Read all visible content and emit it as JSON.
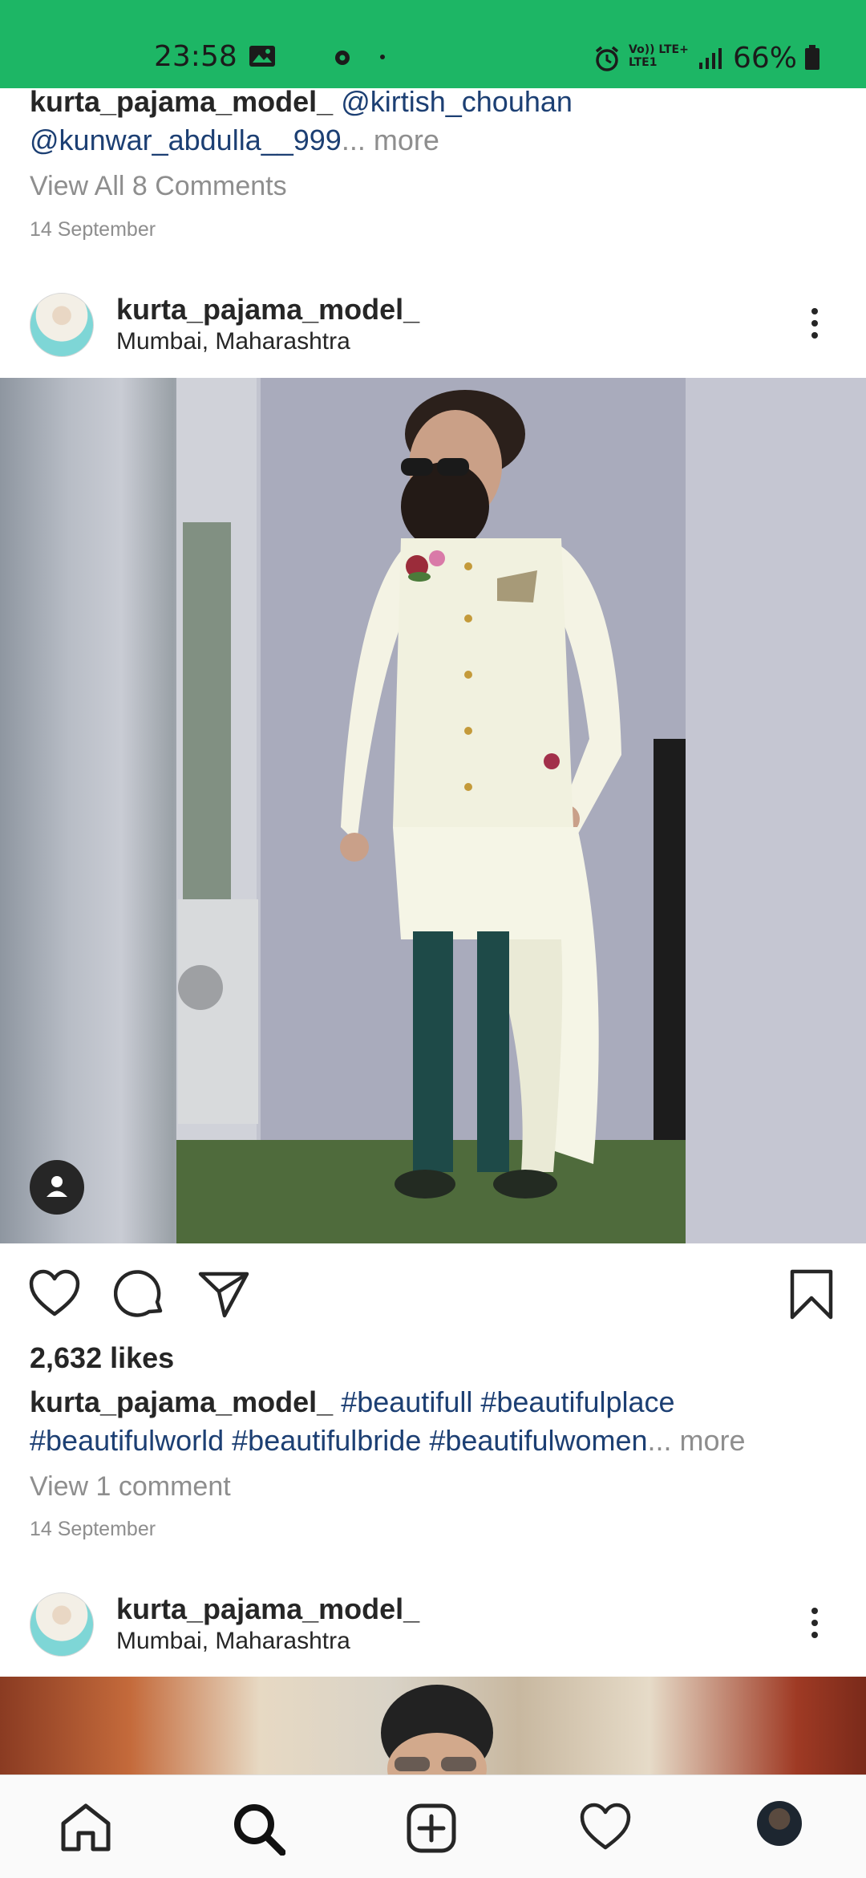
{
  "status_bar": {
    "time": "23:58",
    "network_top": "Vo)) LTE+",
    "network_bottom": "LTE1",
    "battery": "66%"
  },
  "prev_post": {
    "caption_user": "kurta_pajama_model_",
    "caption_line1_tag": "@kirtish_chouhan",
    "caption_line2_tag": "@kunwar_abdulla__999",
    "more": "... more",
    "view_comments": "View All 8 Comments",
    "date": "14 September"
  },
  "post": {
    "username": "kurta_pajama_model_",
    "location": "Mumbai, Maharashtra",
    "likes": "2,632 likes",
    "caption_user": "kurta_pajama_model_",
    "caption_line1_tags": "#beautifull #beautifulplace",
    "caption_line2_tags": "#beautifulworld #beautifulbride #beautifulwomen",
    "more": "... more",
    "view_comments": "View 1 comment",
    "date": "14 September"
  },
  "next_post": {
    "username": "kurta_pajama_model_",
    "location": "Mumbai, Maharashtra"
  },
  "icons": {
    "like": "heart-icon",
    "comment": "comment-icon",
    "share": "send-icon",
    "save": "bookmark-icon",
    "home": "home-icon",
    "search": "search-icon",
    "new_post": "plus-square-icon",
    "activity": "heart-icon",
    "profile": "avatar"
  },
  "colors": {
    "status_bar": "#1db665",
    "hashtag": "#1c3f73",
    "secondary_text": "#8e8e8e"
  }
}
